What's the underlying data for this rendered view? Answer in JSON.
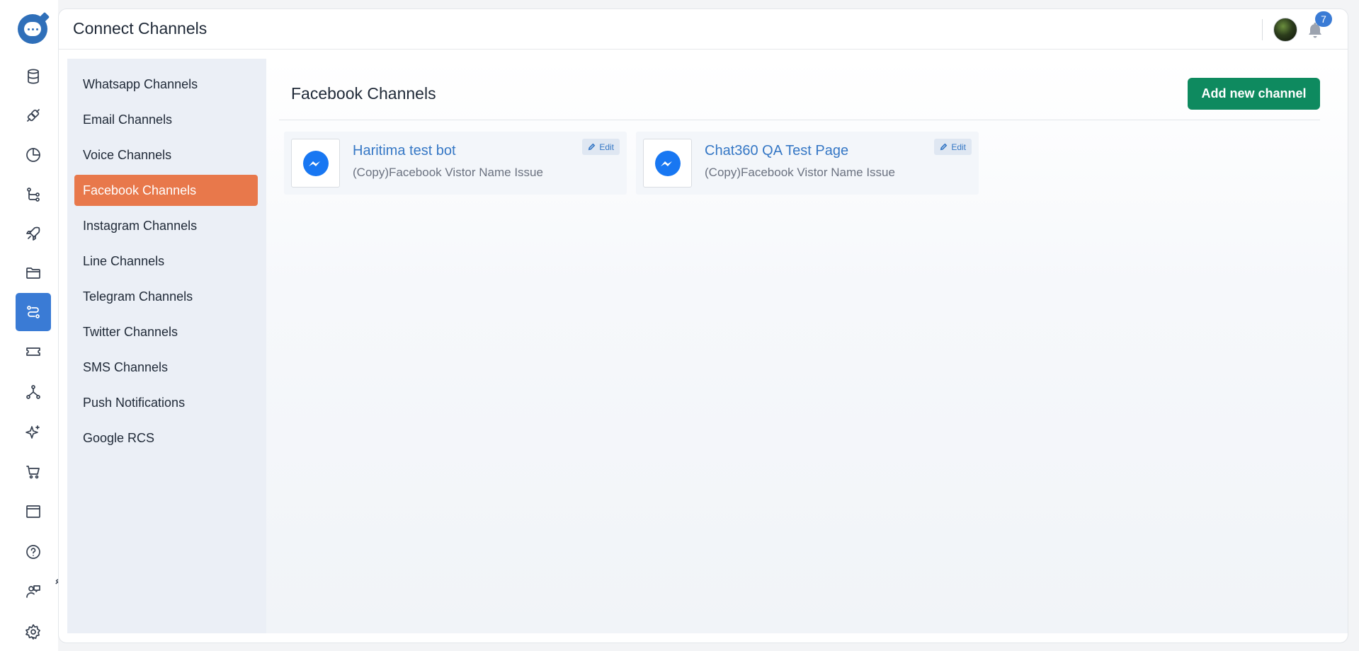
{
  "header": {
    "title": "Connect Channels",
    "notification_count": "7"
  },
  "rail": {
    "items": [
      {
        "icon": "database-icon"
      },
      {
        "icon": "plug-icon"
      },
      {
        "icon": "pie-chart-icon"
      },
      {
        "icon": "flow-icon"
      },
      {
        "icon": "rocket-icon"
      },
      {
        "icon": "folder-icon"
      },
      {
        "icon": "channels-icon",
        "active": true
      },
      {
        "icon": "ticket-icon"
      },
      {
        "icon": "network-icon"
      },
      {
        "icon": "sparkle-icon"
      },
      {
        "icon": "cart-icon"
      },
      {
        "icon": "window-icon"
      },
      {
        "icon": "help-icon"
      },
      {
        "icon": "agent-icon"
      },
      {
        "icon": "settings-icon"
      }
    ]
  },
  "nav": {
    "items": [
      {
        "label": "Whatsapp Channels"
      },
      {
        "label": "Email Channels"
      },
      {
        "label": "Voice Channels"
      },
      {
        "label": "Facebook Channels",
        "active": true
      },
      {
        "label": "Instagram Channels"
      },
      {
        "label": "Line Channels"
      },
      {
        "label": "Telegram Channels"
      },
      {
        "label": "Twitter Channels"
      },
      {
        "label": "SMS Channels"
      },
      {
        "label": "Push Notifications"
      },
      {
        "label": "Google RCS"
      }
    ]
  },
  "main": {
    "section_title": "Facebook Channels",
    "add_button_label": "Add new channel",
    "channels": [
      {
        "name": "Haritima test bot",
        "description": "(Copy)Facebook Vistor Name Issue",
        "edit_label": "Edit",
        "icon": "messenger-icon"
      },
      {
        "name": "Chat360 QA Test Page",
        "description": "(Copy)Facebook Vistor Name Issue",
        "edit_label": "Edit",
        "icon": "messenger-icon"
      }
    ]
  },
  "colors": {
    "accent_blue": "#3a7bd5",
    "active_nav": "#e8784b",
    "primary_button": "#0e8a5f",
    "link_blue": "#3577c5",
    "messenger": "#1877f2"
  }
}
